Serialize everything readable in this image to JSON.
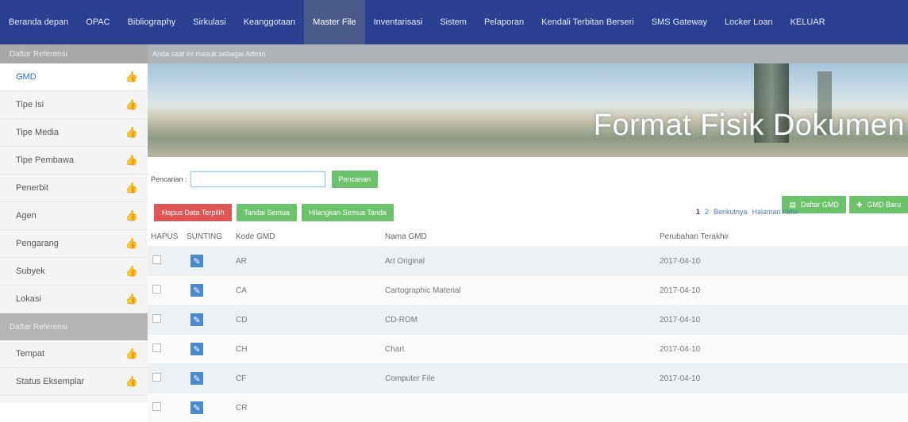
{
  "nav": {
    "items": [
      "Beranda depan",
      "OPAC",
      "Bibliography",
      "Sirkulasi",
      "Keanggotaan",
      "Master File",
      "Inventarisasi",
      "Sistem",
      "Pelaporan",
      "Kendali Terbitan Berseri",
      "SMS Gateway",
      "Locker Loan",
      "KELUAR"
    ],
    "active_index": 5
  },
  "sidebar": {
    "header": "Daftar Referensi",
    "items": [
      "GMD",
      "Tipe Isi",
      "Tipe Media",
      "Tipe Pembawa",
      "Penerbit",
      "Agen",
      "Pengarang",
      "Subyek",
      "Lokasi"
    ],
    "subheader": "Daftar Referensi",
    "items2": [
      "Tempat",
      "Status Eksemplar"
    ],
    "thumb_icon": "thumbs-up-icon"
  },
  "main": {
    "info": "Anda saat ini masuk sebagai Admin",
    "banner_title": "Format Fisik Dokumen",
    "search_label": "Pencarian :",
    "search_value": "",
    "search_button": "Pencarian",
    "list_button": "Daftar GMD",
    "new_button": "GMD Baru",
    "delete_button": "Hapus Data Terpilih",
    "mark_all_button": "Tandai Semua",
    "unmark_all_button": "Hilangkan Semua Tanda",
    "pager": {
      "current": "1",
      "page2": "2",
      "next": "Berikutnya",
      "last": "Halaman Akhir"
    }
  },
  "table": {
    "headers": [
      "HAPUS",
      "SUNTING",
      "Kode GMD",
      "Nama GMD",
      "Perubahan Terakhir"
    ],
    "rows": [
      {
        "code": "AR",
        "name": "Art Original",
        "date": "2017-04-10"
      },
      {
        "code": "CA",
        "name": "Cartographic Material",
        "date": "2017-04-10"
      },
      {
        "code": "CD",
        "name": "CD-ROM",
        "date": "2017-04-10"
      },
      {
        "code": "CH",
        "name": "Chart",
        "date": "2017-04-10"
      },
      {
        "code": "CF",
        "name": "Computer File",
        "date": "2017-04-10"
      },
      {
        "code": "CR",
        "name": "",
        "date": ""
      }
    ]
  },
  "colors": {
    "nav": "#2a3f8f",
    "green": "#6cc36c",
    "red": "#e05555",
    "link": "#4a7fb5"
  }
}
